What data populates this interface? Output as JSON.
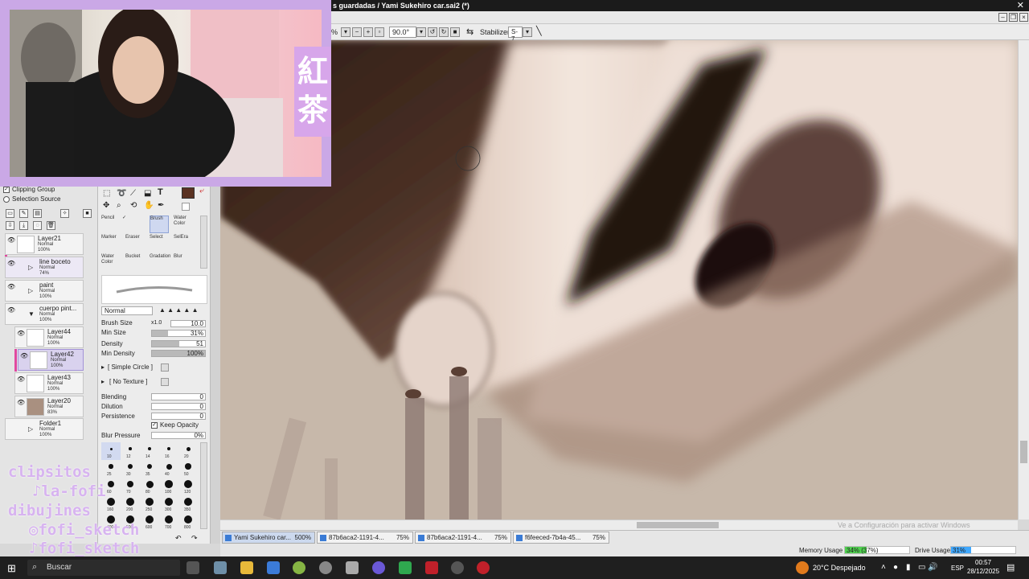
{
  "window": {
    "title": "s guardadas / Yami Sukehiro car.sai2 (*)",
    "close_glyph": "✕"
  },
  "toolbar": {
    "zoom_suffix": "%",
    "rotation": "90.0°",
    "stabilizer_label": "Stabilizer",
    "stabilizer_value": "S-7"
  },
  "layers_panel": {
    "clipping_group": "Clipping Group",
    "selection_source": "Selection Source",
    "layers": [
      {
        "name": "Layer21",
        "blend": "Normal",
        "opacity": "100%"
      },
      {
        "name": "line boceto",
        "blend": "Normal",
        "opacity": "74%"
      },
      {
        "name": "paint",
        "blend": "Normal",
        "opacity": "100%"
      },
      {
        "name": "cuerpo pint...",
        "blend": "Normal",
        "opacity": "100%"
      },
      {
        "name": "Layer44",
        "blend": "Normal",
        "opacity": "100%"
      },
      {
        "name": "Layer42",
        "blend": "Normal",
        "opacity": "100%"
      },
      {
        "name": "Layer43",
        "blend": "Normal",
        "opacity": "100%"
      },
      {
        "name": "Layer20",
        "blend": "Normal",
        "opacity": "83%"
      },
      {
        "name": "Folder1",
        "blend": "Normal",
        "opacity": "100%"
      }
    ]
  },
  "tools_panel": {
    "tools": [
      {
        "label": "Pencil"
      },
      {
        "label": "✓"
      },
      {
        "label": "Brush"
      },
      {
        "label": "Water Color"
      },
      {
        "label": "Marker"
      },
      {
        "label": "Eraser"
      },
      {
        "label": "Select"
      },
      {
        "label": "SelEra"
      },
      {
        "label": "Water Color"
      },
      {
        "label": "Bucket"
      },
      {
        "label": "Gradation"
      },
      {
        "label": "Blur"
      }
    ],
    "blend_mode": "Normal",
    "brush_size_label": "Brush Size",
    "brush_size_mult": "x1.0",
    "brush_size_value": "10.0",
    "min_size_label": "Min Size",
    "min_size_value": "31%",
    "min_size_fraction": 0.31,
    "density_label": "Density",
    "density_value": "51",
    "density_fraction": 0.51,
    "min_density_label": "Min Density",
    "min_density_value": "100%",
    "min_density_fraction": 1.0,
    "shape": "[ Simple Circle ]",
    "texture": "[ No Texture ]",
    "blending_label": "Blending",
    "blending_value": "0",
    "dilution_label": "Dilution",
    "dilution_value": "0",
    "persistence_label": "Persistence",
    "persistence_value": "0",
    "keep_opacity_label": "Keep Opacity",
    "blur_pressure_label": "Blur Pressure",
    "blur_pressure_value": "0%",
    "brush_sizes": [
      "10",
      "12",
      "14",
      "16",
      "20",
      "25",
      "30",
      "35",
      "40",
      "50",
      "60",
      "70",
      "80",
      "100",
      "120",
      "160",
      "200",
      "250",
      "300",
      "350",
      "400",
      "500",
      "600",
      "700",
      "800"
    ]
  },
  "overlay": {
    "kanji_1": "紅",
    "kanji_2": "茶",
    "lines": [
      "clipsitos ",
      "la-fofi",
      "dibujines ",
      "fofi_sketch",
      "fofi_sketch"
    ]
  },
  "canvas_watermark": "Ve a Configuración para activar Windows",
  "doc_tabs": [
    {
      "name": "Yami Sukehiro car...",
      "zoom": "500%"
    },
    {
      "name": "87b6aca2-1191-4...",
      "zoom": "75%"
    },
    {
      "name": "87b6aca2-1191-4...",
      "zoom": "75%"
    },
    {
      "name": "f6feeced-7b4a-45...",
      "zoom": "75%"
    }
  ],
  "status": {
    "memory_label": "Memory Usage",
    "memory_value": "34% (37%)",
    "memory_fraction": 0.34,
    "drive_label": "Drive Usage",
    "drive_value": "31%",
    "drive_fraction": 0.31
  },
  "taskbar": {
    "search_placeholder": "Buscar",
    "weather": "20°C  Despejado",
    "lang": "ESP",
    "time": "00:57",
    "date": "28/12/2025"
  },
  "colors": {
    "accent_purple": "#caa8e6",
    "memory_fill": "#4fd14f",
    "drive_fill": "#3fa8ff",
    "primary_color": "#5a3222"
  }
}
